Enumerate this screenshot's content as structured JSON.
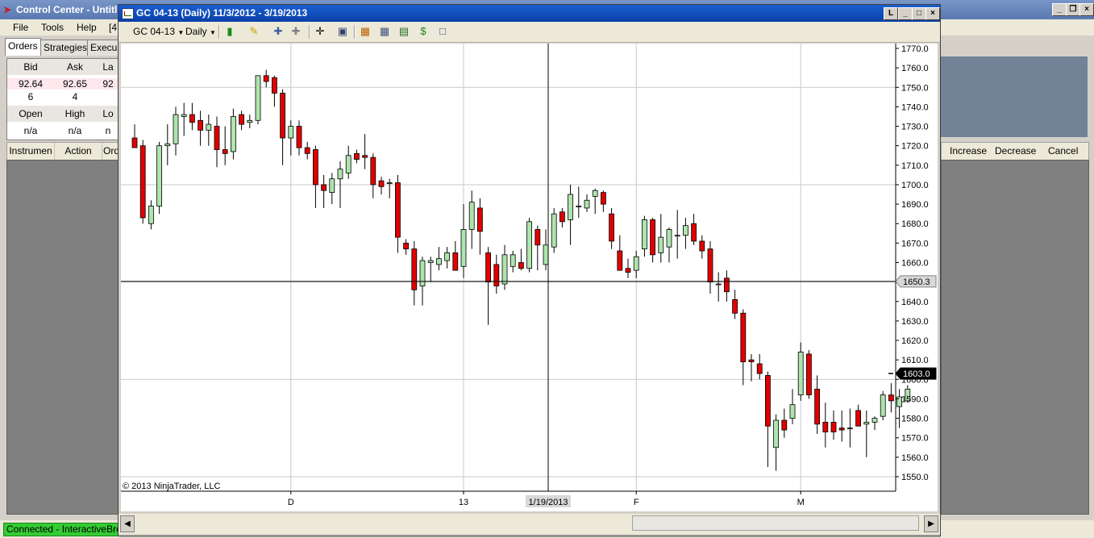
{
  "control_center": {
    "title": "Control Center - Untitl",
    "menu": [
      "File",
      "Tools",
      "Help",
      "[4"
    ],
    "tabs": [
      "Orders",
      "Strategies",
      "Execu"
    ],
    "quote": {
      "bid_label": "Bid",
      "ask_label": "Ask",
      "last_label": "La",
      "bid": "92.64",
      "ask": "92.65",
      "last": "92",
      "bid_size": "6",
      "ask_size": "4",
      "open_label": "Open",
      "high_label": "High",
      "low_label": "Lo",
      "open": "n/a",
      "high": "n/a",
      "low": "n"
    },
    "order_columns": [
      "Instrumen",
      "Action",
      "Ord"
    ],
    "order_actions": [
      "Increase",
      "Decrease",
      "Cancel"
    ],
    "status": "Connected - InteractiveBroke"
  },
  "chart_window": {
    "title": "GC 04-13 (Daily)  11/3/2012 - 3/19/2013",
    "instrument": "GC 04-13",
    "period": "Daily",
    "copyright": "© 2013 NinjaTrader, LLC",
    "crosshair_price": "1650.3",
    "crosshair_date": "1/19/2013",
    "last_price": "1603.0",
    "colors": {
      "up": "#aee4ae",
      "down": "#e00000",
      "wick": "#000000",
      "grid": "#c8c8c8",
      "axis_text": "#000000"
    }
  },
  "chart_data": {
    "type": "candlestick",
    "ylim": [
      1545,
      1775
    ],
    "y_ticks": [
      1550,
      1560,
      1570,
      1580,
      1590,
      1600,
      1610,
      1620,
      1630,
      1640,
      1650,
      1660,
      1670,
      1680,
      1690,
      1700,
      1710,
      1720,
      1730,
      1740,
      1750,
      1760,
      1770
    ],
    "x_labels": [
      {
        "label": "D",
        "index": 19
      },
      {
        "label": "13",
        "index": 40
      },
      {
        "label": "F",
        "index": 61
      },
      {
        "label": "M",
        "index": 81
      }
    ],
    "candles": [
      {
        "o": 1724,
        "h": 1731,
        "l": 1720,
        "c": 1719
      },
      {
        "o": 1720,
        "h": 1723,
        "l": 1680,
        "c": 1683
      },
      {
        "o": 1680,
        "h": 1692,
        "l": 1677,
        "c": 1689
      },
      {
        "o": 1689,
        "h": 1722,
        "l": 1685,
        "c": 1720
      },
      {
        "o": 1720,
        "h": 1731,
        "l": 1710,
        "c": 1721
      },
      {
        "o": 1721,
        "h": 1740,
        "l": 1715,
        "c": 1736
      },
      {
        "o": 1735,
        "h": 1742,
        "l": 1725,
        "c": 1736
      },
      {
        "o": 1736,
        "h": 1742,
        "l": 1728,
        "c": 1732
      },
      {
        "o": 1733,
        "h": 1738,
        "l": 1720,
        "c": 1728
      },
      {
        "o": 1728,
        "h": 1736,
        "l": 1720,
        "c": 1731
      },
      {
        "o": 1730,
        "h": 1735,
        "l": 1709,
        "c": 1718
      },
      {
        "o": 1718,
        "h": 1730,
        "l": 1710,
        "c": 1716
      },
      {
        "o": 1717,
        "h": 1739,
        "l": 1713,
        "c": 1735
      },
      {
        "o": 1736,
        "h": 1738,
        "l": 1728,
        "c": 1731
      },
      {
        "o": 1732,
        "h": 1736,
        "l": 1729,
        "c": 1733
      },
      {
        "o": 1733,
        "h": 1750,
        "l": 1731,
        "c": 1756
      },
      {
        "o": 1756,
        "h": 1759,
        "l": 1750,
        "c": 1753
      },
      {
        "o": 1755,
        "h": 1756,
        "l": 1740,
        "c": 1747
      },
      {
        "o": 1747,
        "h": 1749,
        "l": 1710,
        "c": 1724
      },
      {
        "o": 1724,
        "h": 1733,
        "l": 1715,
        "c": 1730
      },
      {
        "o": 1730,
        "h": 1733,
        "l": 1715,
        "c": 1719
      },
      {
        "o": 1719,
        "h": 1722,
        "l": 1713,
        "c": 1716
      },
      {
        "o": 1718,
        "h": 1720,
        "l": 1688,
        "c": 1700
      },
      {
        "o": 1700,
        "h": 1705,
        "l": 1688,
        "c": 1697
      },
      {
        "o": 1696,
        "h": 1706,
        "l": 1690,
        "c": 1703
      },
      {
        "o": 1703,
        "h": 1712,
        "l": 1688,
        "c": 1708
      },
      {
        "o": 1706,
        "h": 1720,
        "l": 1703,
        "c": 1715
      },
      {
        "o": 1716,
        "h": 1718,
        "l": 1711,
        "c": 1713
      },
      {
        "o": 1715,
        "h": 1726,
        "l": 1708,
        "c": 1714
      },
      {
        "o": 1714,
        "h": 1716,
        "l": 1693,
        "c": 1700
      },
      {
        "o": 1702,
        "h": 1704,
        "l": 1695,
        "c": 1699
      },
      {
        "o": 1701,
        "h": 1703,
        "l": 1693,
        "c": 1701
      },
      {
        "o": 1701,
        "h": 1705,
        "l": 1665,
        "c": 1673
      },
      {
        "o": 1670,
        "h": 1672,
        "l": 1664,
        "c": 1667
      },
      {
        "o": 1667,
        "h": 1671,
        "l": 1638,
        "c": 1646
      },
      {
        "o": 1648,
        "h": 1663,
        "l": 1638,
        "c": 1661
      },
      {
        "o": 1660,
        "h": 1663,
        "l": 1650,
        "c": 1661
      },
      {
        "o": 1659,
        "h": 1668,
        "l": 1656,
        "c": 1662
      },
      {
        "o": 1661,
        "h": 1668,
        "l": 1657,
        "c": 1665
      },
      {
        "o": 1665,
        "h": 1671,
        "l": 1657,
        "c": 1656
      },
      {
        "o": 1658,
        "h": 1690,
        "l": 1652,
        "c": 1677
      },
      {
        "o": 1677,
        "h": 1697,
        "l": 1667,
        "c": 1691
      },
      {
        "o": 1688,
        "h": 1693,
        "l": 1664,
        "c": 1676
      },
      {
        "o": 1665,
        "h": 1668,
        "l": 1628,
        "c": 1650
      },
      {
        "o": 1659,
        "h": 1664,
        "l": 1644,
        "c": 1648
      },
      {
        "o": 1649,
        "h": 1669,
        "l": 1646,
        "c": 1664
      },
      {
        "o": 1658,
        "h": 1666,
        "l": 1655,
        "c": 1664
      },
      {
        "o": 1660,
        "h": 1667,
        "l": 1656,
        "c": 1657
      },
      {
        "o": 1657,
        "h": 1683,
        "l": 1655,
        "c": 1681
      },
      {
        "o": 1677,
        "h": 1679,
        "l": 1656,
        "c": 1669
      },
      {
        "o": 1659,
        "h": 1677,
        "l": 1656,
        "c": 1669
      },
      {
        "o": 1668,
        "h": 1688,
        "l": 1665,
        "c": 1685
      },
      {
        "o": 1686,
        "h": 1688,
        "l": 1678,
        "c": 1681
      },
      {
        "o": 1682,
        "h": 1700,
        "l": 1669,
        "c": 1695
      },
      {
        "o": 1689,
        "h": 1699,
        "l": 1683,
        "c": 1689
      },
      {
        "o": 1688,
        "h": 1695,
        "l": 1686,
        "c": 1692
      },
      {
        "o": 1694,
        "h": 1698,
        "l": 1685,
        "c": 1697
      },
      {
        "o": 1696,
        "h": 1697,
        "l": 1686,
        "c": 1690
      },
      {
        "o": 1685,
        "h": 1688,
        "l": 1667,
        "c": 1671
      },
      {
        "o": 1666,
        "h": 1674,
        "l": 1657,
        "c": 1656
      },
      {
        "o": 1657,
        "h": 1662,
        "l": 1652,
        "c": 1655
      },
      {
        "o": 1656,
        "h": 1666,
        "l": 1652,
        "c": 1663
      },
      {
        "o": 1667,
        "h": 1684,
        "l": 1663,
        "c": 1682
      },
      {
        "o": 1682,
        "h": 1683,
        "l": 1660,
        "c": 1664
      },
      {
        "o": 1665,
        "h": 1685,
        "l": 1660,
        "c": 1673
      },
      {
        "o": 1668,
        "h": 1678,
        "l": 1660,
        "c": 1677
      },
      {
        "o": 1674,
        "h": 1687,
        "l": 1662,
        "c": 1674
      },
      {
        "o": 1674,
        "h": 1683,
        "l": 1667,
        "c": 1679
      },
      {
        "o": 1680,
        "h": 1685,
        "l": 1669,
        "c": 1671
      },
      {
        "o": 1671,
        "h": 1674,
        "l": 1662,
        "c": 1666
      },
      {
        "o": 1667,
        "h": 1671,
        "l": 1644,
        "c": 1650
      },
      {
        "o": 1649,
        "h": 1655,
        "l": 1640,
        "c": 1649
      },
      {
        "o": 1652,
        "h": 1656,
        "l": 1640,
        "c": 1645
      },
      {
        "o": 1641,
        "h": 1646,
        "l": 1631,
        "c": 1634
      },
      {
        "o": 1634,
        "h": 1636,
        "l": 1597,
        "c": 1609
      },
      {
        "o": 1610,
        "h": 1613,
        "l": 1599,
        "c": 1609
      },
      {
        "o": 1608,
        "h": 1613,
        "l": 1600,
        "c": 1603
      },
      {
        "o": 1602,
        "h": 1604,
        "l": 1555,
        "c": 1576
      },
      {
        "o": 1565,
        "h": 1582,
        "l": 1553,
        "c": 1579
      },
      {
        "o": 1579,
        "h": 1585,
        "l": 1570,
        "c": 1574
      },
      {
        "o": 1580,
        "h": 1595,
        "l": 1577,
        "c": 1587
      },
      {
        "o": 1592,
        "h": 1619,
        "l": 1589,
        "c": 1614
      },
      {
        "o": 1613,
        "h": 1615,
        "l": 1590,
        "c": 1592
      },
      {
        "o": 1595,
        "h": 1602,
        "l": 1572,
        "c": 1577
      },
      {
        "o": 1578,
        "h": 1588,
        "l": 1565,
        "c": 1573
      },
      {
        "o": 1578,
        "h": 1584,
        "l": 1569,
        "c": 1573
      },
      {
        "o": 1575,
        "h": 1584,
        "l": 1568,
        "c": 1574
      },
      {
        "o": 1575,
        "h": 1585,
        "l": 1565,
        "c": 1575
      },
      {
        "o": 1584,
        "h": 1587,
        "l": 1576,
        "c": 1576
      },
      {
        "o": 1577,
        "h": 1584,
        "l": 1560,
        "c": 1578
      },
      {
        "o": 1578,
        "h": 1581,
        "l": 1574,
        "c": 1580
      },
      {
        "o": 1581,
        "h": 1594,
        "l": 1579,
        "c": 1592
      },
      {
        "o": 1592,
        "h": 1598,
        "l": 1583,
        "c": 1589
      },
      {
        "o": 1586,
        "h": 1595,
        "l": 1575,
        "c": 1591
      },
      {
        "o": 1589,
        "h": 1597,
        "l": 1588,
        "c": 1595
      }
    ]
  }
}
